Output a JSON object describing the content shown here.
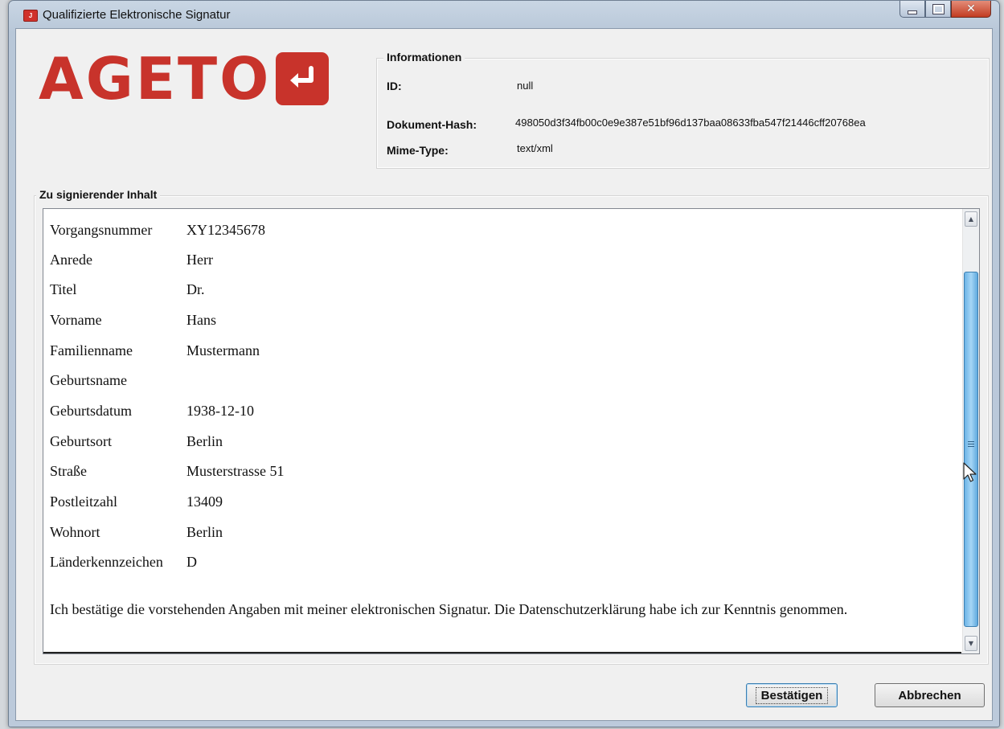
{
  "window": {
    "title": "Qualifizierte Elektronische Signatur",
    "app_icon": "java-app-icon",
    "controls": [
      "minimize-icon",
      "maximize-icon",
      "close-icon"
    ]
  },
  "logo": {
    "text": "AGETO",
    "icon": "enter-arrow-icon",
    "color": "#c8332b"
  },
  "info": {
    "legend": "Informationen",
    "rows": [
      {
        "key": "ID:",
        "value": "null"
      },
      {
        "key": "Dokument-Hash:",
        "value": "498050d3f34fb00c0e9e387e51bf96d137baa08633fba547f21446cff20768ea"
      },
      {
        "key": "Mime-Type:",
        "value": "text/xml"
      }
    ]
  },
  "content": {
    "legend": "Zu signierender Inhalt",
    "fields": [
      {
        "label": "Vorgangsnummer",
        "value": "XY12345678"
      },
      {
        "label": "Anrede",
        "value": "Herr"
      },
      {
        "label": "Titel",
        "value": "Dr."
      },
      {
        "label": "Vorname",
        "value": "Hans"
      },
      {
        "label": "Familienname",
        "value": "Mustermann"
      },
      {
        "label": "Geburtsname",
        "value": ""
      },
      {
        "label": "Geburtsdatum",
        "value": "1938-12-10"
      },
      {
        "label": "Geburtsort",
        "value": "Berlin"
      },
      {
        "label": "Straße",
        "value": "Musterstrasse 51"
      },
      {
        "label": "Postleitzahl",
        "value": "13409"
      },
      {
        "label": "Wohnort",
        "value": "Berlin"
      },
      {
        "label": "Länderkennzeichen",
        "value": "D"
      }
    ],
    "confirmation": "Ich bestätige die vorstehenden Angaben mit meiner elektronischen Signatur. Die Datenschutzerklärung habe ich zur Kenntnis genommen."
  },
  "buttons": {
    "confirm": "Bestätigen",
    "cancel": "Abbrechen"
  },
  "accent_color": "#3c7fb1"
}
